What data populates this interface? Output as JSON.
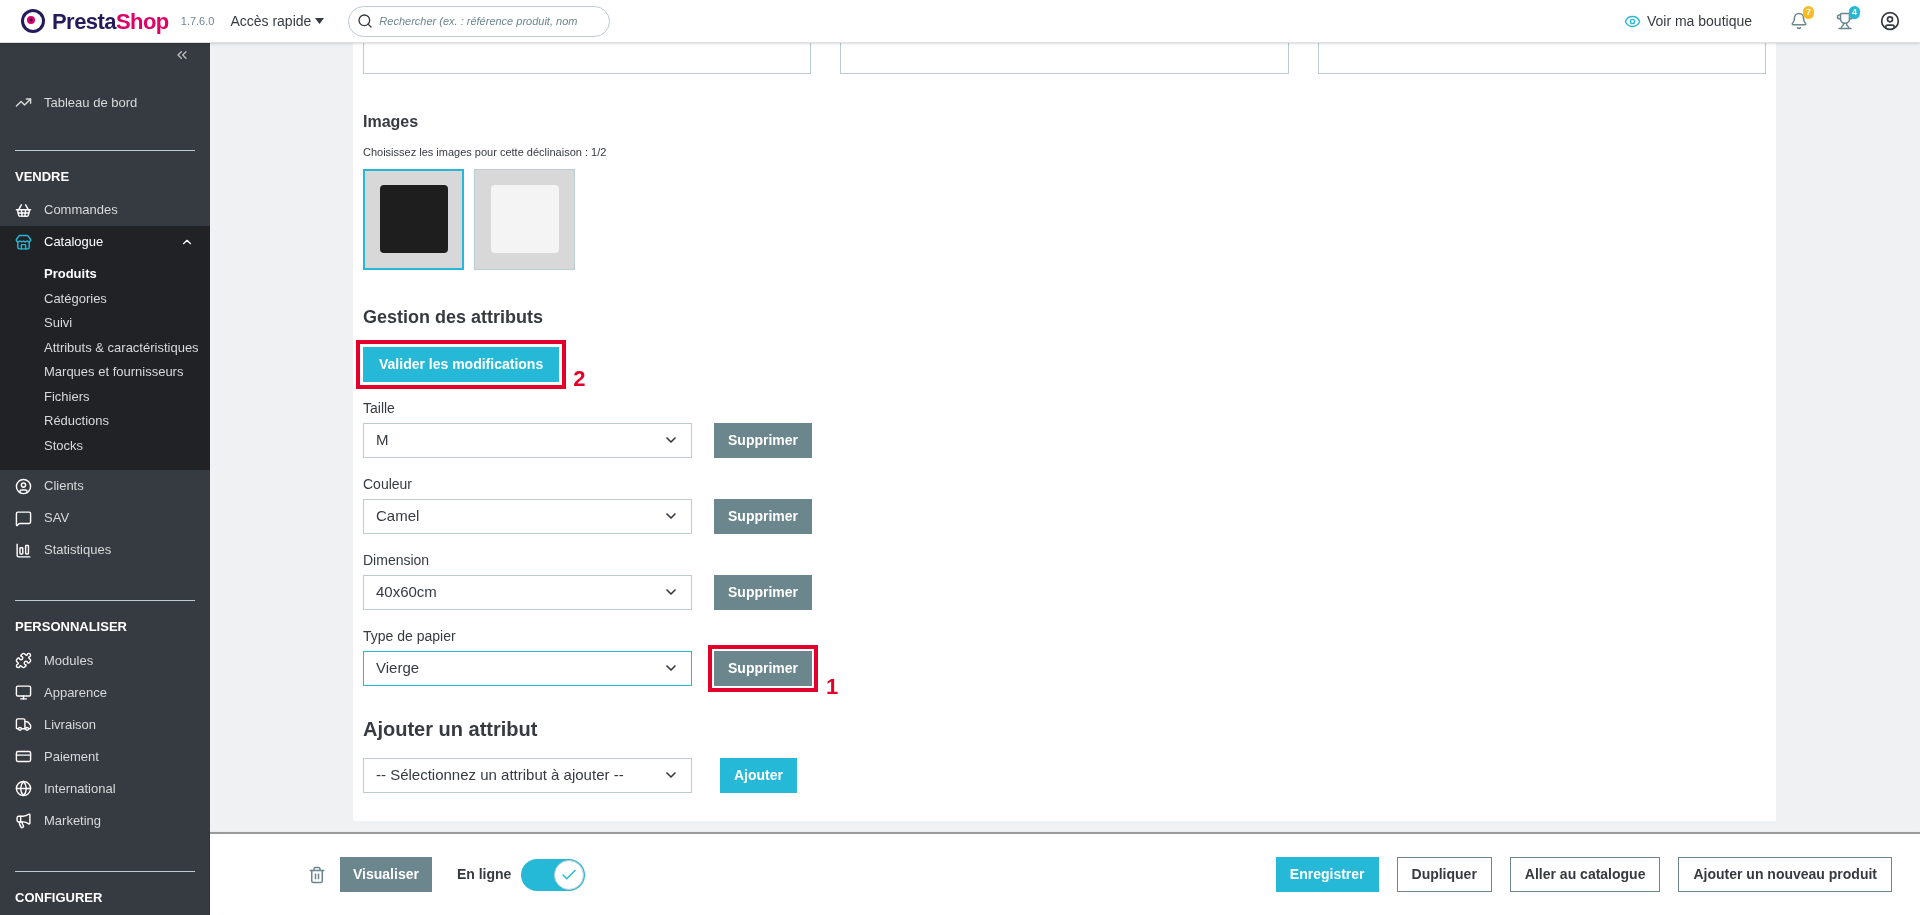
{
  "topbar": {
    "logo_part_1": "Presta",
    "logo_part_2": "Shop",
    "version": "1.7.6.0",
    "quick_access": "Accès rapide",
    "search": {
      "placeholder": "Rechercher (ex. : référence produit, nom"
    },
    "view_shop": "Voir ma boutique",
    "notifications_count": "7",
    "trophy_count": "4"
  },
  "sidebar": {
    "top_item": {
      "label": "Tableau de bord"
    },
    "sections": [
      {
        "title": "VENDRE",
        "items": [
          {
            "label": "Commandes",
            "expanded": false,
            "selected": false
          },
          {
            "label": "Catalogue",
            "expanded": true,
            "selected": true,
            "children": [
              {
                "label": "Produits",
                "selected": true
              },
              {
                "label": "Catégories",
                "selected": false
              },
              {
                "label": "Suivi",
                "selected": false
              },
              {
                "label": "Attributs & caractéristiques",
                "selected": false
              },
              {
                "label": "Marques et fournisseurs",
                "selected": false
              },
              {
                "label": "Fichiers",
                "selected": false
              },
              {
                "label": "Réductions",
                "selected": false
              },
              {
                "label": "Stocks",
                "selected": false
              }
            ]
          },
          {
            "label": "Clients",
            "expanded": false,
            "selected": false
          },
          {
            "label": "SAV",
            "expanded": false,
            "selected": false
          },
          {
            "label": "Statistiques",
            "expanded": false,
            "selected": false
          }
        ]
      },
      {
        "title": "PERSONNALISER",
        "items": [
          {
            "label": "Modules",
            "expanded": false,
            "selected": false
          },
          {
            "label": "Apparence",
            "expanded": false,
            "selected": false
          },
          {
            "label": "Livraison",
            "expanded": false,
            "selected": false
          },
          {
            "label": "Paiement",
            "expanded": false,
            "selected": false
          },
          {
            "label": "International",
            "expanded": false,
            "selected": false
          },
          {
            "label": "Marketing",
            "expanded": false,
            "selected": false
          }
        ]
      },
      {
        "title": "CONFIGURER"
      }
    ]
  },
  "images": {
    "title": "Images",
    "subtitle": "Choisissez les images pour cette déclinaison : 1/2",
    "items": [
      {
        "selected": true
      },
      {
        "selected": false
      }
    ]
  },
  "attributes": {
    "title": "Gestion des attributs",
    "validate_button": {
      "label": "Valider les modifications",
      "annotation": "2"
    },
    "rows": [
      {
        "label": "Taille",
        "value": "M",
        "focused": false,
        "delete_label": "Supprimer"
      },
      {
        "label": "Couleur",
        "value": "Camel",
        "focused": false,
        "delete_label": "Supprimer"
      },
      {
        "label": "Dimension",
        "value": "40x60cm",
        "focused": false,
        "delete_label": "Supprimer"
      },
      {
        "label": "Type de papier",
        "value": "Vierge",
        "focused": true,
        "delete_label": "Supprimer",
        "annotation": "1"
      }
    ]
  },
  "add_attribute": {
    "title": "Ajouter un attribut",
    "select_value": "-- Sélectionnez un attribut à ajouter --",
    "button": "Ajouter"
  },
  "footer": {
    "preview": "Visualiser",
    "online_label": "En ligne",
    "online": true,
    "buttons": [
      {
        "label": "Enregistrer",
        "kind": "primary"
      },
      {
        "label": "Dupliquer",
        "kind": "outline"
      },
      {
        "label": "Aller au catalogue",
        "kind": "outline"
      },
      {
        "label": "Ajouter un nouveau produit",
        "kind": "outline"
      }
    ]
  }
}
